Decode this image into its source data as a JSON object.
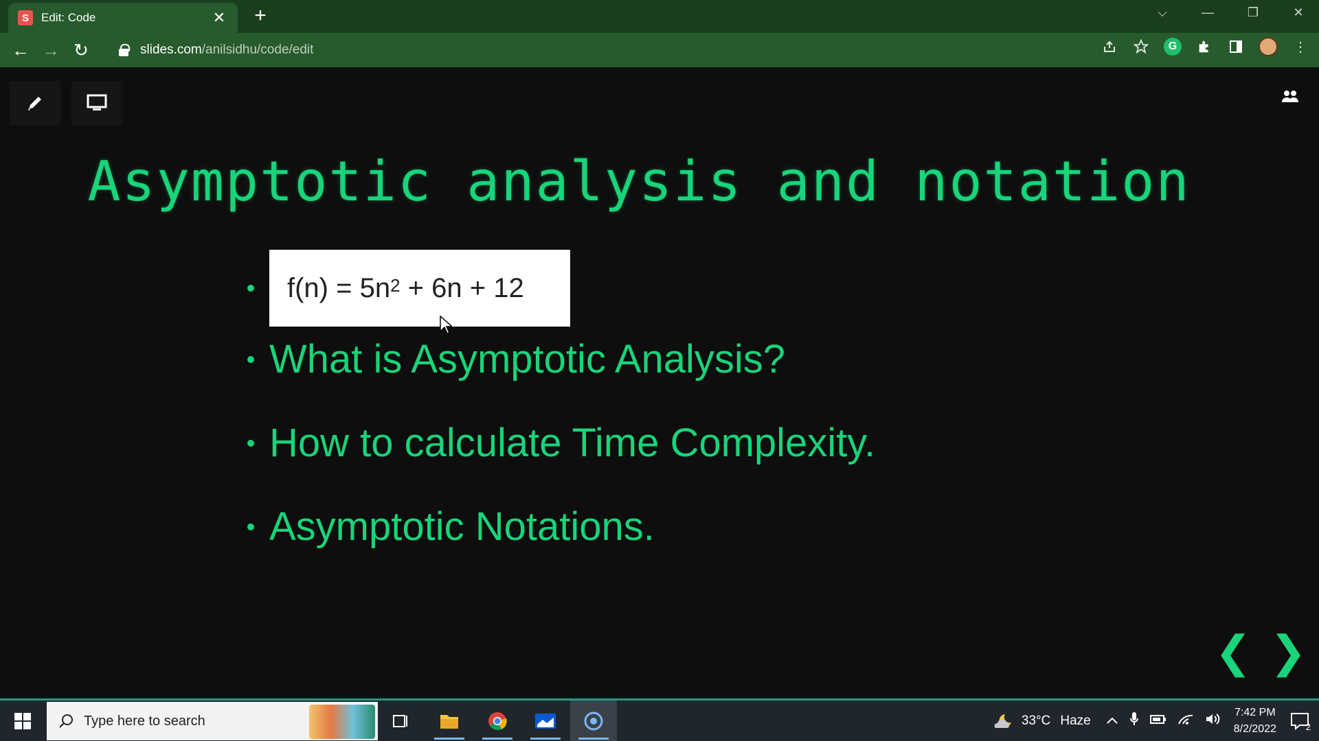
{
  "browser": {
    "tab": {
      "favicon": "S",
      "title": "Edit: Code",
      "close": "✕"
    },
    "new_tab": "+",
    "window_controls": {
      "tabs_menu": "⌵",
      "minimize": "—",
      "restore": "❐",
      "close": "✕"
    },
    "nav": {
      "back": "←",
      "forward": "→",
      "reload": "↻"
    },
    "url": {
      "host": "slides.com",
      "path": "/anilsidhu/code/edit"
    },
    "toolbar_icons": [
      "share-icon",
      "star-icon",
      "grammarly-icon",
      "extensions-icon",
      "sidepanel-icon",
      "profile-avatar",
      "menu-icon"
    ],
    "grammarly_label": "G",
    "menu_glyph": "⋮"
  },
  "slide": {
    "title": "Asymptotic analysis and notation",
    "formula": {
      "base": "f(n) = 5n",
      "exponent": "2",
      "rest": " + 6n + 12"
    },
    "bullets": [
      "What is Asymptotic Analysis?",
      "How to calculate Time Complexity.",
      "Asymptotic Notations."
    ],
    "prev_arrow": "❮",
    "next_arrow": "❯"
  },
  "taskbar": {
    "search_placeholder": "Type here to search",
    "weather": {
      "temp": "33°C",
      "condition": "Haze"
    },
    "clock": {
      "time": "7:42 PM",
      "date": "8/2/2022"
    },
    "notification_count": "2",
    "colors": {
      "accent": "#19d47a",
      "taskbar": "#20262b"
    }
  }
}
